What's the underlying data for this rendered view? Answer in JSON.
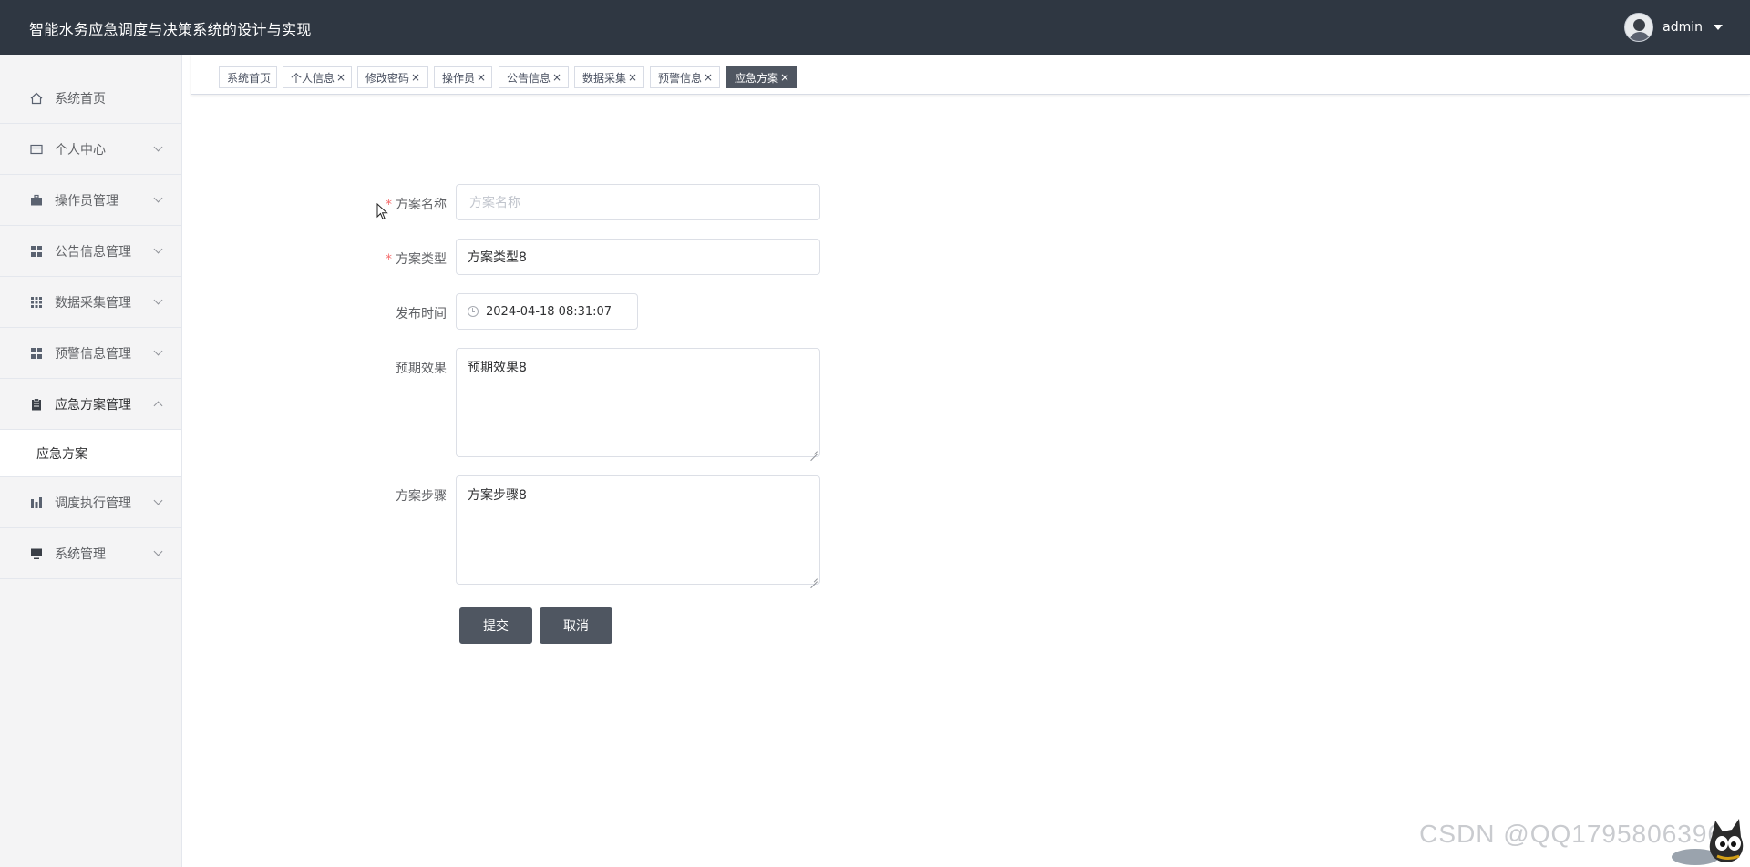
{
  "header": {
    "title": "智能水务应急调度与决策系统的设计与实现",
    "username": "admin"
  },
  "sidebar": {
    "items": [
      {
        "label": "系统首页",
        "icon": "home-icon"
      },
      {
        "label": "个人中心",
        "icon": "card-icon"
      },
      {
        "label": "操作员管理",
        "icon": "briefcase-icon"
      },
      {
        "label": "公告信息管理",
        "icon": "grid-icon"
      },
      {
        "label": "数据采集管理",
        "icon": "apps-icon"
      },
      {
        "label": "预警信息管理",
        "icon": "grid-icon"
      },
      {
        "label": "应急方案管理",
        "icon": "clipboard-icon"
      },
      {
        "label": "调度执行管理",
        "icon": "chart-icon"
      },
      {
        "label": "系统管理",
        "icon": "monitor-icon"
      }
    ],
    "submenu": {
      "label": "应急方案"
    }
  },
  "tabs": [
    {
      "label": "系统首页",
      "closable": false
    },
    {
      "label": "个人信息",
      "closable": true
    },
    {
      "label": "修改密码",
      "closable": true
    },
    {
      "label": "操作员",
      "closable": true
    },
    {
      "label": "公告信息",
      "closable": true
    },
    {
      "label": "数据采集",
      "closable": true
    },
    {
      "label": "预警信息",
      "closable": true
    },
    {
      "label": "应急方案",
      "closable": true,
      "active": true
    }
  ],
  "tab_close_glyph": "×",
  "form": {
    "name_label": "方案名称",
    "name_placeholder": "方案名称",
    "name_value": "",
    "type_label": "方案类型",
    "type_value": "方案类型8",
    "time_label": "发布时间",
    "time_value": "2024-04-18 08:31:07",
    "effect_label": "预期效果",
    "effect_value": "预期效果8",
    "steps_label": "方案步骤",
    "steps_value": "方案步骤8",
    "required_mark": "*",
    "submit_label": "提交",
    "cancel_label": "取消"
  },
  "watermark": "CSDN @QQ1795806396",
  "colors": {
    "header_bg": "#2f3742",
    "sidebar_bg": "#f4f4f5",
    "button_bg": "#4f5661",
    "active_tab_bg": "#4f5661",
    "required": "#f56c6c"
  }
}
